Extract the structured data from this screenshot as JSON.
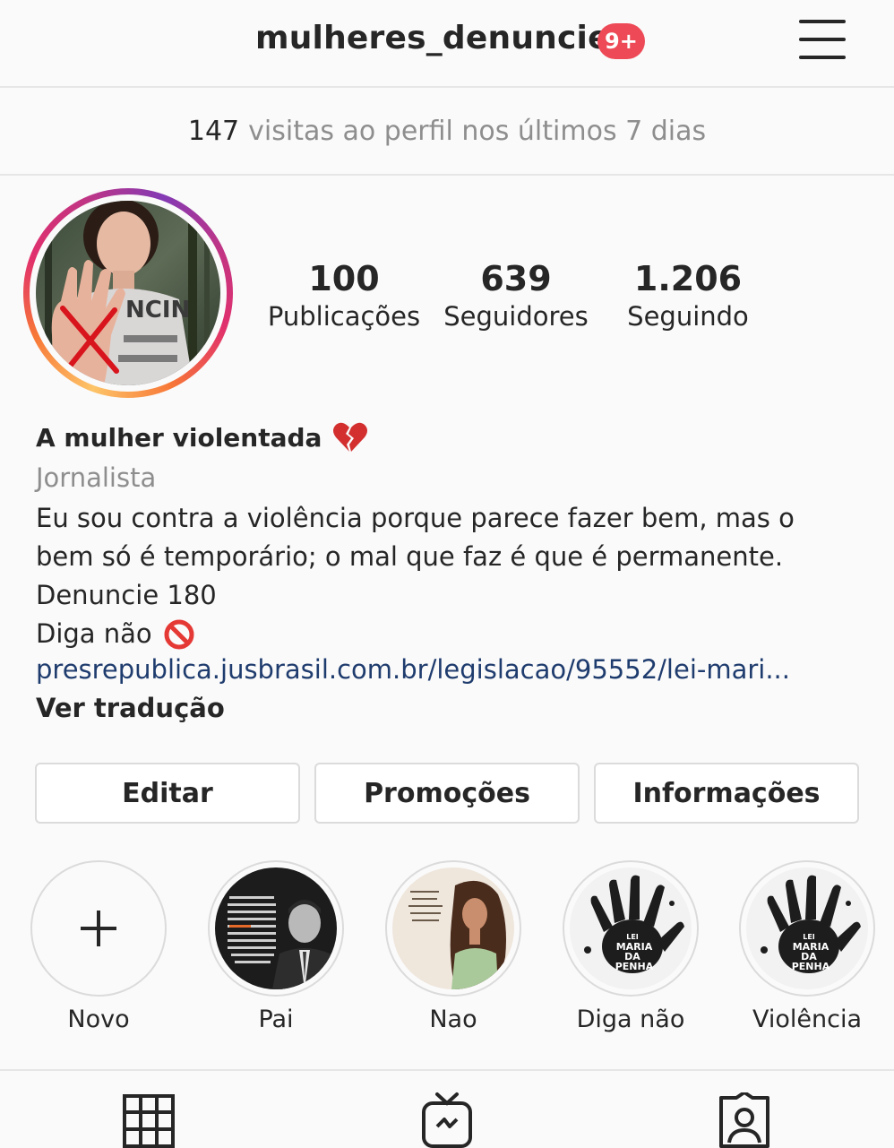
{
  "header": {
    "username": "mulheres_denuncie",
    "notification_badge": "9+"
  },
  "insights": {
    "visits_count": "147",
    "visits_label": "visitas ao perfil nos últimos 7 dias"
  },
  "stats": [
    {
      "value": "100",
      "label": "Publicações"
    },
    {
      "value": "639",
      "label": "Seguidores"
    },
    {
      "value": "1.206",
      "label": "Seguindo"
    }
  ],
  "bio": {
    "name": "A mulher violentada",
    "category": "Jornalista",
    "lines": [
      "Eu sou contra a violência porque parece fazer bem, mas o",
      "bem só é temporário; o mal que faz é que é permanente.",
      "Denuncie 180",
      "Diga não"
    ],
    "link": "presrepublica.jusbrasil.com.br/legislacao/95552/lei-mari...",
    "translate": "Ver tradução"
  },
  "buttons": {
    "edit": "Editar",
    "promotions": "Promoções",
    "info": "Informações"
  },
  "highlights": [
    {
      "label": "Novo"
    },
    {
      "label": "Pai"
    },
    {
      "label": "Nao"
    },
    {
      "label": "Diga não"
    },
    {
      "label": "Violência"
    }
  ],
  "highlight_images_text": {
    "maria_da_penha": [
      "LEI",
      "MARIA",
      "DA",
      "PENHA"
    ]
  },
  "avatar_shirt_text": "NCIN",
  "colors": {
    "badge": "#ed4956",
    "link": "#1f3c6e",
    "muted": "#8e8e8e"
  }
}
